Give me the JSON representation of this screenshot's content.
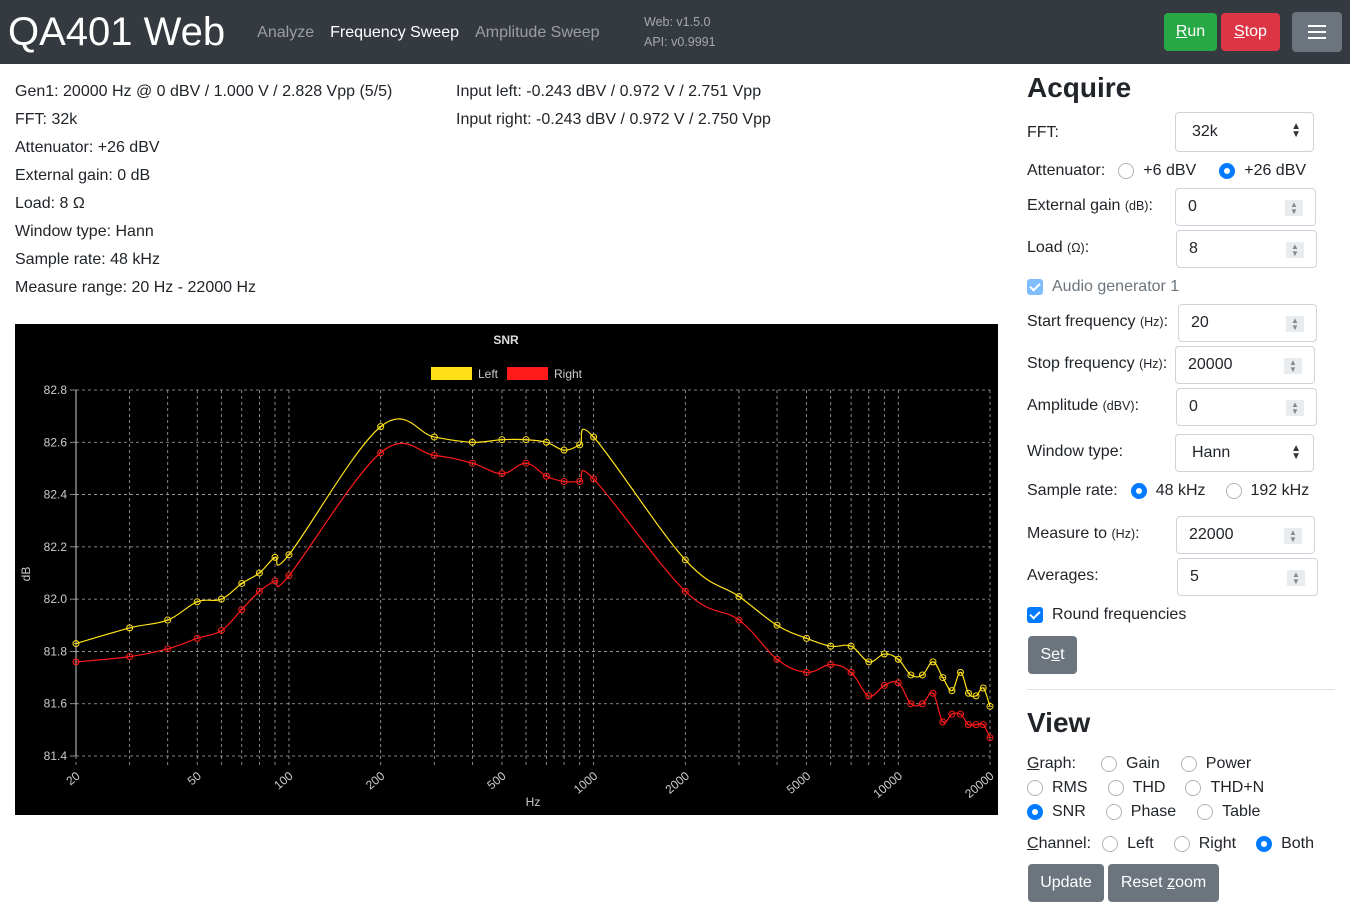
{
  "navbar": {
    "brand": "QA401 Web",
    "links": [
      {
        "label": "Analyze",
        "active": false
      },
      {
        "label": "Frequency Sweep",
        "active": true
      },
      {
        "label": "Amplitude Sweep",
        "active": false
      }
    ],
    "web_version": "Web: v1.5.0",
    "api_version": "API: v0.9991",
    "run_first": "R",
    "run_rest": "un",
    "stop_first": "S",
    "stop_rest": "top",
    "menu_icon": "hamburger-icon"
  },
  "status": {
    "left": [
      "Gen1: 20000 Hz @ 0 dBV / 1.000 V / 2.828 Vpp (5/5)",
      "FFT: 32k",
      "Attenuator: +26 dBV",
      "External gain: 0 dB",
      "Load: 8 Ω",
      "Window type: Hann",
      "Sample rate: 48 kHz",
      "Measure range: 20 Hz - 22000 Hz"
    ],
    "right": [
      "Input left: -0.243 dBV / 0.972 V / 2.751 Vpp",
      "Input right: -0.243 dBV / 0.972 V / 2.750 Vpp"
    ]
  },
  "acquire": {
    "title": "Acquire",
    "fft_label": "FFT:",
    "fft_value": "32k",
    "attenuator_label": "Attenuator:",
    "attenuator_options": [
      "+6 dBV",
      "+26 dBV"
    ],
    "attenuator_selected": "+26 dBV",
    "external_gain_label": "External gain",
    "external_gain_unit": "(dB)",
    "external_gain_value": "0",
    "load_label": "Load",
    "load_unit": "(Ω)",
    "load_value": "8",
    "audio_gen_label": "Audio generator 1",
    "audio_gen_checked": true,
    "start_freq_label": "Start frequency",
    "start_freq_unit": "(Hz)",
    "start_freq_value": "20",
    "stop_freq_label": "Stop frequency",
    "stop_freq_unit": "(Hz)",
    "stop_freq_value": "20000",
    "amplitude_label": "Amplitude",
    "amplitude_unit": "(dBV)",
    "amplitude_value": "0",
    "window_label": "Window type:",
    "window_value": "Hann",
    "sample_rate_label": "Sample rate:",
    "sample_rate_options": [
      "48 kHz",
      "192 kHz"
    ],
    "sample_rate_selected": "48 kHz",
    "measure_to_label": "Measure to",
    "measure_to_unit": "(Hz)",
    "measure_to_value": "22000",
    "averages_label": "Averages:",
    "averages_value": "5",
    "round_freq_label": "Round frequencies",
    "round_freq_checked": true,
    "set_first": "S",
    "set_underlined": "e",
    "set_rest": "t"
  },
  "view": {
    "title": "View",
    "graph_label_u": "G",
    "graph_label_rest": "raph:",
    "graph_options": [
      "Gain",
      "Power",
      "RMS",
      "THD",
      "THD+N",
      "SNR",
      "Phase",
      "Table"
    ],
    "graph_selected": "SNR",
    "channel_label_u": "C",
    "channel_label_rest": "hannel:",
    "channel_options": [
      "Left",
      "Right",
      "Both"
    ],
    "channel_selected": "Both",
    "update_label": "Update",
    "reset_first": "Reset ",
    "reset_u": "z",
    "reset_rest": "oom"
  },
  "chart_data": {
    "type": "line",
    "title": "SNR",
    "xlabel": "Hz",
    "ylabel": "dB",
    "xscale": "log",
    "xlim": [
      20,
      20000
    ],
    "ylim": [
      81.4,
      82.8
    ],
    "yticks": [
      "82.8",
      "82.6",
      "82.4",
      "82.2",
      "82.0",
      "81.8",
      "81.6",
      "81.4"
    ],
    "xticks": [
      "20",
      "50",
      "100",
      "200",
      "500",
      "1000",
      "2000",
      "5000",
      "10000",
      "20000"
    ],
    "grid": true,
    "legend": "top-center",
    "series": [
      {
        "name": "Left",
        "color": "#ffe119",
        "points": [
          [
            20,
            81.83
          ],
          [
            30,
            81.89
          ],
          [
            40,
            81.92
          ],
          [
            50,
            81.99
          ],
          [
            60,
            82.0
          ],
          [
            70,
            82.06
          ],
          [
            80,
            82.1
          ],
          [
            90,
            82.16
          ],
          [
            100,
            82.17
          ],
          [
            200,
            82.66
          ],
          [
            300,
            82.62
          ],
          [
            400,
            82.6
          ],
          [
            500,
            82.61
          ],
          [
            600,
            82.61
          ],
          [
            700,
            82.6
          ],
          [
            800,
            82.57
          ],
          [
            900,
            82.59
          ],
          [
            1000,
            82.62
          ],
          [
            2000,
            82.15
          ],
          [
            3000,
            82.01
          ],
          [
            4000,
            81.9
          ],
          [
            5000,
            81.85
          ],
          [
            6000,
            81.82
          ],
          [
            7000,
            81.82
          ],
          [
            8000,
            81.76
          ],
          [
            9000,
            81.79
          ],
          [
            10000,
            81.77
          ],
          [
            11000,
            81.71
          ],
          [
            12000,
            81.71
          ],
          [
            13000,
            81.76
          ],
          [
            14000,
            81.7
          ],
          [
            15000,
            81.65
          ],
          [
            16000,
            81.72
          ],
          [
            17000,
            81.64
          ],
          [
            18000,
            81.63
          ],
          [
            19000,
            81.66
          ],
          [
            20000,
            81.59
          ]
        ]
      },
      {
        "name": "Right",
        "color": "#ff1a1a",
        "points": [
          [
            20,
            81.76
          ],
          [
            30,
            81.78
          ],
          [
            40,
            81.81
          ],
          [
            50,
            81.85
          ],
          [
            60,
            81.88
          ],
          [
            70,
            81.96
          ],
          [
            80,
            82.03
          ],
          [
            90,
            82.07
          ],
          [
            100,
            82.09
          ],
          [
            200,
            82.56
          ],
          [
            300,
            82.55
          ],
          [
            400,
            82.52
          ],
          [
            500,
            82.48
          ],
          [
            600,
            82.52
          ],
          [
            700,
            82.47
          ],
          [
            800,
            82.45
          ],
          [
            900,
            82.45
          ],
          [
            1000,
            82.46
          ],
          [
            2000,
            82.03
          ],
          [
            3000,
            81.92
          ],
          [
            4000,
            81.77
          ],
          [
            5000,
            81.72
          ],
          [
            6000,
            81.75
          ],
          [
            7000,
            81.72
          ],
          [
            8000,
            81.63
          ],
          [
            9000,
            81.67
          ],
          [
            10000,
            81.68
          ],
          [
            11000,
            81.6
          ],
          [
            12000,
            81.6
          ],
          [
            13000,
            81.64
          ],
          [
            14000,
            81.53
          ],
          [
            15000,
            81.56
          ],
          [
            16000,
            81.56
          ],
          [
            17000,
            81.52
          ],
          [
            18000,
            81.52
          ],
          [
            19000,
            81.52
          ],
          [
            20000,
            81.47
          ]
        ]
      }
    ]
  }
}
